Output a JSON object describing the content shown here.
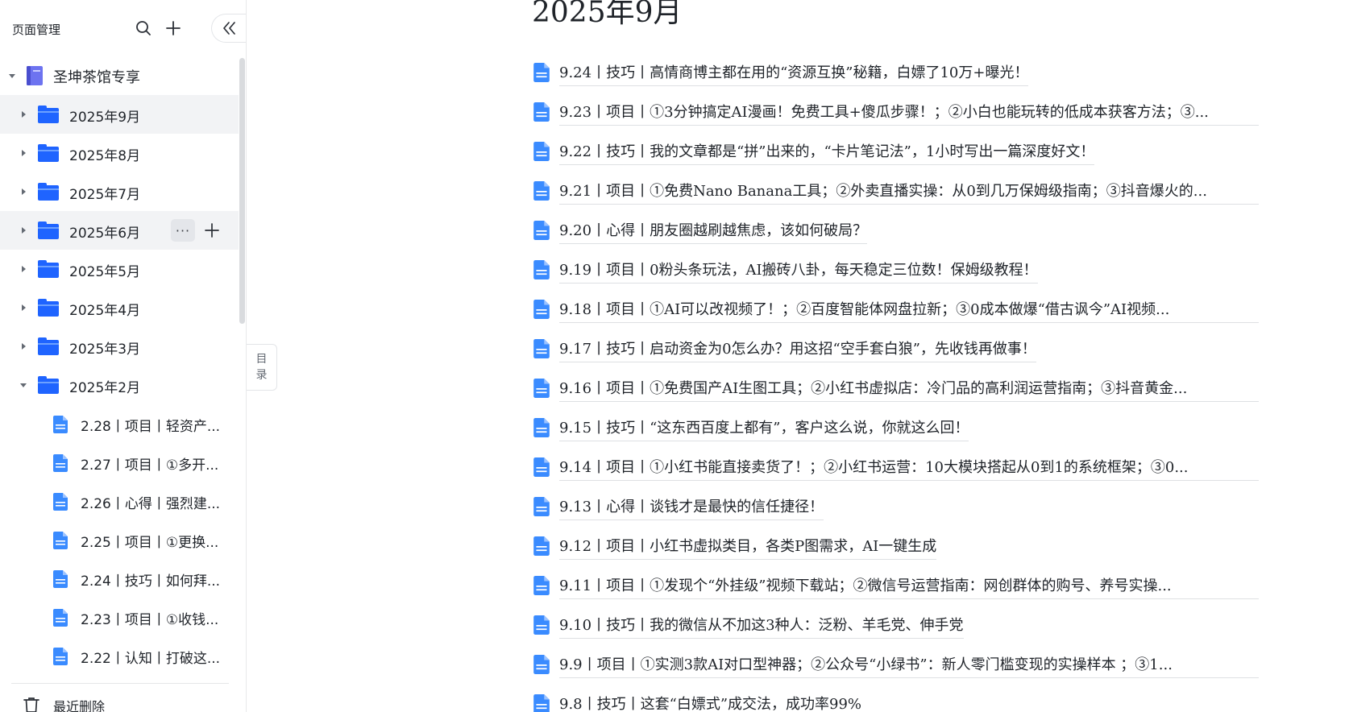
{
  "sidebar": {
    "title": "页面管理",
    "tree": [
      {
        "label": "圣坤茶馆专享",
        "type": "book",
        "level": 0,
        "expanded": true
      },
      {
        "label": "2025年9月",
        "type": "folder",
        "level": 1,
        "expanded": false,
        "highlighted": true
      },
      {
        "label": "2025年8月",
        "type": "folder",
        "level": 1,
        "expanded": false
      },
      {
        "label": "2025年7月",
        "type": "folder",
        "level": 1,
        "expanded": false
      },
      {
        "label": "2025年6月",
        "type": "folder",
        "level": 1,
        "expanded": false,
        "hovered": true
      },
      {
        "label": "2025年5月",
        "type": "folder",
        "level": 1,
        "expanded": false
      },
      {
        "label": "2025年4月",
        "type": "folder",
        "level": 1,
        "expanded": false
      },
      {
        "label": "2025年3月",
        "type": "folder",
        "level": 1,
        "expanded": false
      },
      {
        "label": "2025年2月",
        "type": "folder",
        "level": 1,
        "expanded": true
      },
      {
        "label": "2.28丨项目丨轻资产...",
        "type": "doc",
        "level": 2
      },
      {
        "label": "2.27丨项目丨①多开...",
        "type": "doc",
        "level": 2
      },
      {
        "label": "2.26丨心得丨强烈建...",
        "type": "doc",
        "level": 2
      },
      {
        "label": "2.25丨项目丨①更换...",
        "type": "doc",
        "level": 2
      },
      {
        "label": "2.24丨技巧丨如何拜...",
        "type": "doc",
        "level": 2
      },
      {
        "label": "2.23丨项目丨①收钱...",
        "type": "doc",
        "level": 2
      },
      {
        "label": "2.22丨认知丨打破这...",
        "type": "doc",
        "level": 2
      }
    ],
    "hover_more": "···",
    "recent_delete": "最近删除"
  },
  "toc_toggle": {
    "line1": "目",
    "line2": "录"
  },
  "main": {
    "title": "2025年9月",
    "docs": [
      {
        "label": "9.24丨技巧丨高情商博主都在用的“资源互换”秘籍，白嫖了10万+曝光！",
        "truncated": false
      },
      {
        "label": "9.23丨项目丨①3分钟搞定AI漫画！免费工具+傻瓜步骤！；②小白也能玩转的低成本获客方法；③...",
        "truncated": true
      },
      {
        "label": "9.22丨技巧丨我的文章都是“拼”出来的，“卡片笔记法”，1小时写出一篇深度好文！",
        "truncated": false
      },
      {
        "label": "9.21丨项目丨①免费Nano Banana工具；②外卖直播实操：从0到几万保姆级指南；③抖音爆火的...",
        "truncated": true
      },
      {
        "label": "9.20丨心得丨朋友圈越刷越焦虑，该如何破局？",
        "truncated": false
      },
      {
        "label": "9.19丨项目丨0粉头条玩法，AI搬砖八卦，每天稳定三位数！保姆级教程！",
        "truncated": false
      },
      {
        "label": "9.18丨项目丨①AI可以改视频了！；②百度智能体网盘拉新；③0成本做爆“借古讽今”AI视频...",
        "truncated": true
      },
      {
        "label": "9.17丨技巧丨启动资金为0怎么办？用这招“空手套白狼”，先收钱再做事！",
        "truncated": false
      },
      {
        "label": "9.16丨项目丨①免费国产AI生图工具；②小红书虚拟店：冷门品的高利润运营指南；③抖音黄金...",
        "truncated": true
      },
      {
        "label": "9.15丨技巧丨“这东西百度上都有”，客户这么说，你就这么回！",
        "truncated": false
      },
      {
        "label": "9.14丨项目丨①小红书能直接卖货了！；②小红书运营：10大模块搭起从0到1的系统框架；③0...",
        "truncated": true
      },
      {
        "label": "9.13丨心得丨谈钱才是最快的信任捷径！",
        "truncated": false
      },
      {
        "label": "9.12丨项目丨小红书虚拟类目，各类P图需求，AI一键生成",
        "truncated": false
      },
      {
        "label": "9.11丨项目丨①发现个“外挂级”视频下载站；②微信号运营指南：网创群体的购号、养号实操...",
        "truncated": true
      },
      {
        "label": "9.10丨技巧丨我的微信从不加这3种人：泛粉、羊毛党、伸手党",
        "truncated": false
      },
      {
        "label": "9.9丨项目丨①实测3款AI对口型神器；②公众号“小绿书”：新人零门槛变现的实操样本 ；③1...",
        "truncated": true
      },
      {
        "label": "9.8丨技巧丨这套“白嫖式”成交法，成功率99%",
        "truncated": false
      }
    ]
  },
  "colors": {
    "folder_blue": "#1f64ff",
    "doc_blue": "#3a8bff",
    "book_purple": "#6d73f0",
    "hover_bg": "#f2f3f5",
    "text": "#1f2329"
  }
}
